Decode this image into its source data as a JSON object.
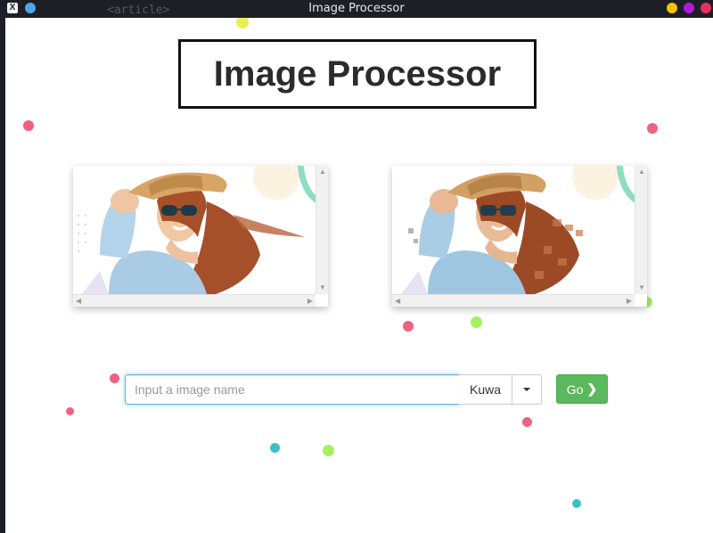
{
  "window": {
    "title": "Image Processor",
    "background_hint": "<article>"
  },
  "page": {
    "heading": "Image Processor"
  },
  "images": {
    "original": {
      "label": "original-image"
    },
    "processed": {
      "label": "processed-image",
      "effect": "kuwahara-painted"
    }
  },
  "controls": {
    "input_placeholder": "Input a image name",
    "input_value": "",
    "algorithm_selected": "Kuwa",
    "go_label": "Go"
  },
  "colors": {
    "go_button": "#5cb85c",
    "focus_ring": "#66afe9",
    "confetti": [
      "#f06080",
      "#a6f060",
      "#3cc0c8",
      "#e6f050"
    ]
  }
}
